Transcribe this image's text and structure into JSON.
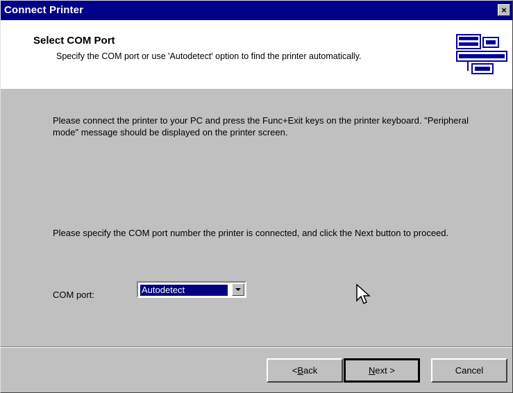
{
  "window": {
    "title": "Connect Printer",
    "close_glyph": "×"
  },
  "header": {
    "title": "Select COM Port",
    "subtitle": "Specify the COM port or use 'Autodetect' option to find the printer automatically.",
    "icon": "printer-display-icon"
  },
  "body": {
    "instruction1": "Please connect the printer to your PC and press the Func+Exit keys on the printer keyboard. \"Peripheral mode\" message should be displayed on the printer screen.",
    "instruction2": "Please specify the COM port number the printer is connected, and click the Next button to proceed.",
    "com_label": "COM port:",
    "com_value": "Autodetect"
  },
  "buttons": {
    "back_prefix": "< ",
    "back_key": "B",
    "back_rest": "ack",
    "next_key": "N",
    "next_rest": "ext >",
    "cancel": "Cancel"
  }
}
